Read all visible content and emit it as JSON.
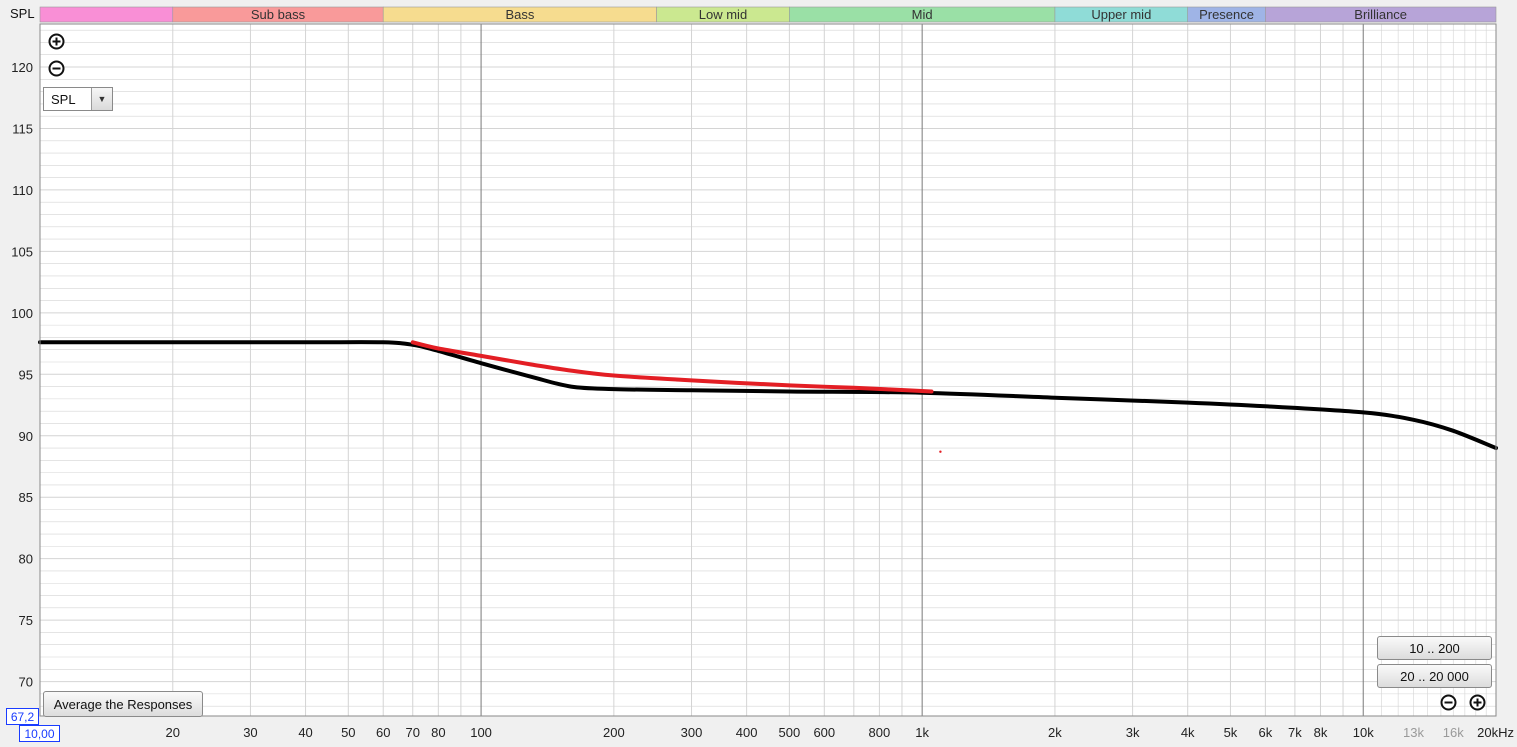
{
  "window": {
    "y_axis_tag": "SPL"
  },
  "controls": {
    "zoom_in_icon": "zoom-in-icon",
    "zoom_out_icon": "zoom-out-icon",
    "spl_select_value": "SPL",
    "dropdown_icon": "chevron-down-icon",
    "average_button": "Average the Responses",
    "range_button_1": "10 .. 200",
    "range_button_2": "20 .. 20 000",
    "y_corner_value": "67,2",
    "x_corner_value": "10,00"
  },
  "colors": {
    "plot_bg": "#ffffff",
    "frame_bg": "#f0f0f0",
    "grid_minor": "#d4d4d4",
    "grid_major": "#7a7a7a",
    "series_black": "#000000",
    "series_red": "#e31e24",
    "corner_box": "#1a3cff"
  },
  "chart_data": {
    "type": "line",
    "x_scale": "log",
    "xlim": [
      10,
      20000
    ],
    "ylim": [
      67.2,
      123.5
    ],
    "yticks": [
      70,
      75,
      80,
      85,
      90,
      95,
      100,
      105,
      110,
      115,
      120
    ],
    "xticks": [
      {
        "value": 20,
        "label": "20"
      },
      {
        "value": 30,
        "label": "30"
      },
      {
        "value": 40,
        "label": "40"
      },
      {
        "value": 50,
        "label": "50"
      },
      {
        "value": 60,
        "label": "60"
      },
      {
        "value": 70,
        "label": "70"
      },
      {
        "value": 80,
        "label": "80"
      },
      {
        "value": 100,
        "label": "100"
      },
      {
        "value": 200,
        "label": "200"
      },
      {
        "value": 300,
        "label": "300"
      },
      {
        "value": 400,
        "label": "400"
      },
      {
        "value": 500,
        "label": "500"
      },
      {
        "value": 600,
        "label": "600"
      },
      {
        "value": 800,
        "label": "800"
      },
      {
        "value": 1000,
        "label": "1k"
      },
      {
        "value": 2000,
        "label": "2k"
      },
      {
        "value": 3000,
        "label": "3k"
      },
      {
        "value": 4000,
        "label": "4k"
      },
      {
        "value": 5000,
        "label": "5k"
      },
      {
        "value": 6000,
        "label": "6k"
      },
      {
        "value": 7000,
        "label": "7k"
      },
      {
        "value": 8000,
        "label": "8k"
      },
      {
        "value": 10000,
        "label": "10k"
      },
      {
        "value": 13000,
        "label": "13k",
        "muted": true
      },
      {
        "value": 16000,
        "label": "16k",
        "muted": true
      },
      {
        "value": 20000,
        "label": "20kHz"
      }
    ],
    "major_grid_x": [
      100,
      1000,
      10000
    ],
    "bands": [
      {
        "label": "",
        "from": 10,
        "to": 20,
        "color": "#f98fd6"
      },
      {
        "label": "Sub bass",
        "from": 20,
        "to": 60,
        "color": "#f99a9a"
      },
      {
        "label": "Bass",
        "from": 60,
        "to": 250,
        "color": "#f6dc8f"
      },
      {
        "label": "Low mid",
        "from": 250,
        "to": 500,
        "color": "#cbe890"
      },
      {
        "label": "Mid",
        "from": 500,
        "to": 2000,
        "color": "#9ae0a6"
      },
      {
        "label": "Upper mid",
        "from": 2000,
        "to": 4000,
        "color": "#8fdcd7"
      },
      {
        "label": "Presence",
        "from": 4000,
        "to": 6000,
        "color": "#9fb4e6"
      },
      {
        "label": "Brilliance",
        "from": 6000,
        "to": 20000,
        "color": "#b7a4d8"
      }
    ],
    "series": [
      {
        "color": "#000000",
        "x": [
          10,
          20,
          40,
          60,
          70,
          80,
          100,
          130,
          160,
          200,
          300,
          500,
          1000,
          2000,
          4000,
          6000,
          10000,
          13000,
          16000,
          20000
        ],
        "y": [
          97.6,
          97.6,
          97.6,
          97.6,
          97.4,
          96.9,
          95.9,
          94.8,
          94.0,
          93.8,
          93.7,
          93.6,
          93.5,
          93.1,
          92.7,
          92.4,
          91.9,
          91.3,
          90.4,
          89.0
        ]
      },
      {
        "color": "#e31e24",
        "x": [
          70,
          80,
          100,
          130,
          160,
          200,
          300,
          500,
          700,
          1050
        ],
        "y": [
          97.6,
          97.1,
          96.5,
          95.8,
          95.3,
          94.9,
          94.5,
          94.1,
          93.9,
          93.6
        ]
      }
    ],
    "stray_point": {
      "x": 1100,
      "y": 88.7,
      "color": "#e31e24"
    }
  }
}
